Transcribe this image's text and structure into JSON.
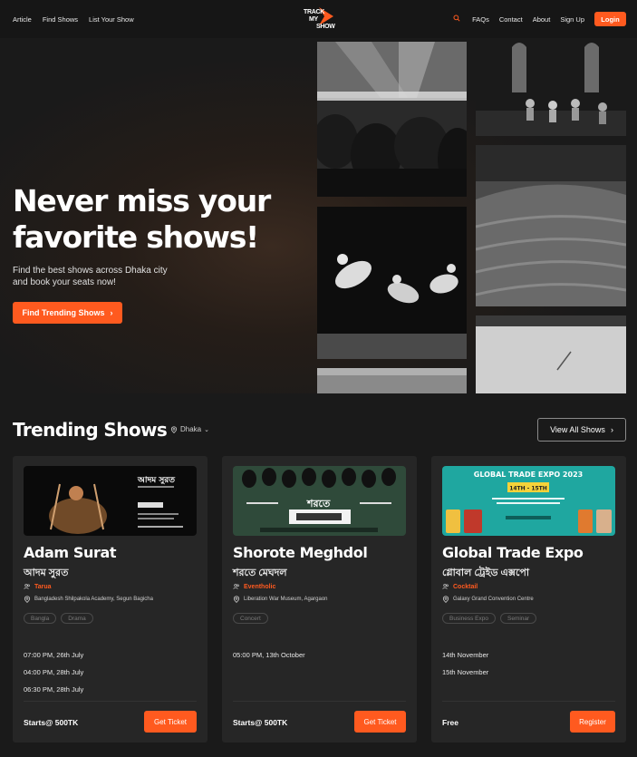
{
  "nav": {
    "left_links": [
      "Article",
      "Find Shows",
      "List Your Show"
    ],
    "logo_lines": [
      "TRACK",
      "MY",
      "SHOW"
    ],
    "right_links": [
      "FAQs",
      "Contact",
      "About",
      "Sign Up"
    ],
    "login_label": "Login",
    "icons": {
      "search": "search-icon"
    }
  },
  "hero": {
    "title_line1": "Never miss your",
    "title_line2": "favorite shows!",
    "subtitle_line1": "Find the best shows across Dhaka city",
    "subtitle_line2": "and book your seats now!",
    "cta_label": "Find Trending Shows"
  },
  "trending": {
    "title": "Trending Shows",
    "city": "Dhaka",
    "view_all_label": "View All Shows"
  },
  "cards": [
    {
      "title": "Adam Surat",
      "title_bn": "আদম সুরত",
      "organizer": "Tarua",
      "venue": "Bangladesh Shilpakola Academy, Segun Bagicha",
      "tags": [
        "Bangla",
        "Drama"
      ],
      "dates": [
        "07:00 PM, 26th July",
        "04:00 PM, 28th July",
        "06:30 PM, 28th July"
      ],
      "price": "Starts@ 500TK",
      "button": "Get Ticket",
      "poster_text": "আদম সুরত"
    },
    {
      "title": "Shorote Meghdol",
      "title_bn": "শরতে মেঘদল",
      "organizer": "Eventholic",
      "venue": "Liberation War Museum, Agargaon",
      "tags": [
        "Concert"
      ],
      "dates": [
        "05:00 PM, 13th October"
      ],
      "price": "Starts@ 500TK",
      "button": "Get Ticket",
      "poster_text": "শরতে"
    },
    {
      "title": "Global Trade Expo",
      "title_bn": "গ্লোবাল ট্রেইড এক্সপো",
      "organizer": "Cocktail",
      "venue": "Galaxy Grand Convention Centre",
      "tags": [
        "Business Expo",
        "Seminar"
      ],
      "dates": [
        "14th November",
        "15th November"
      ],
      "price": "Free",
      "button": "Register",
      "poster_text": "GLOBAL TRADE EXPO 2023",
      "poster_sub": "14TH - 15TH"
    }
  ],
  "colors": {
    "accent": "#ff5a1f",
    "background": "#1a1a1a",
    "card": "#262626",
    "expo_poster": "#1fa7a0"
  }
}
